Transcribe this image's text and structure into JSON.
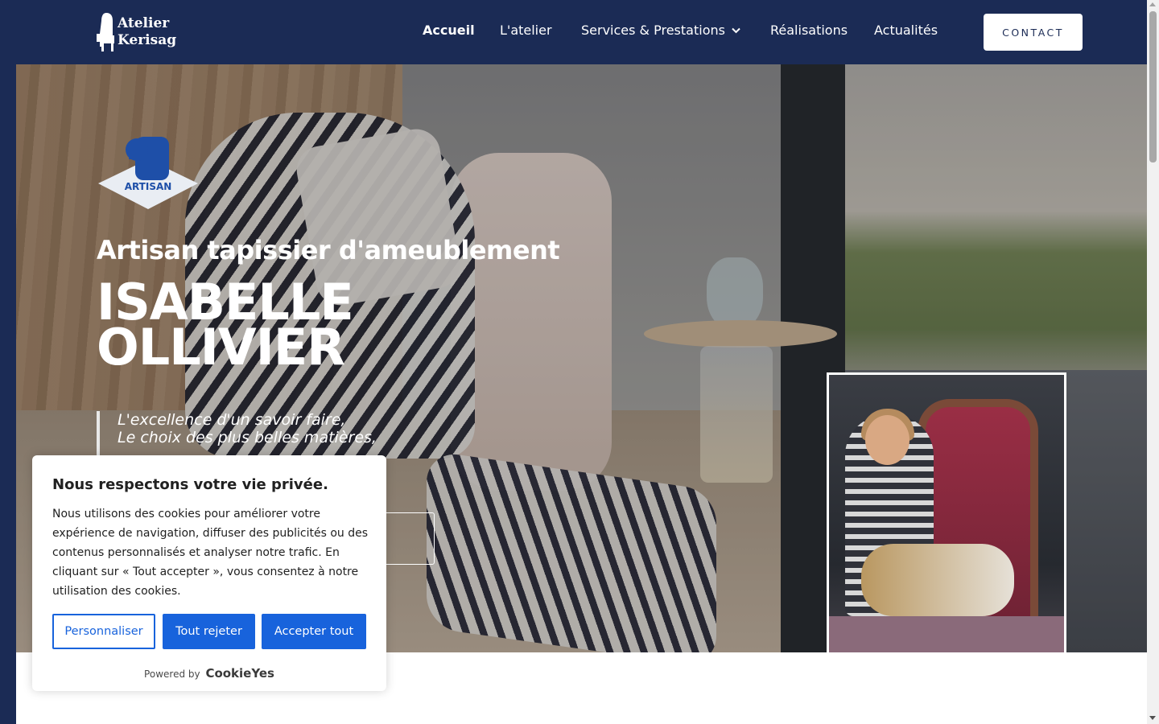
{
  "brand": {
    "line1": "Atelier",
    "line2": "Kerisag"
  },
  "nav": {
    "items": [
      {
        "label": "Accueil",
        "active": true
      },
      {
        "label": "L'atelier"
      },
      {
        "label": "Services & Prestations",
        "has_dropdown": true
      },
      {
        "label": "Réalisations"
      },
      {
        "label": "Actualités"
      }
    ],
    "contact_label": "CONTACT"
  },
  "hero": {
    "badge_label": "ARTISAN",
    "subtitle": "Artisan tapissier d'ameublement",
    "title_line1": "ISABELLE",
    "title_line2": "OLLIVIER",
    "quote_line1": "L'excellence d'un savoir faire,",
    "quote_line2": "Le choix des plus belles matières,"
  },
  "cookie": {
    "title": "Nous respectons votre vie privée.",
    "text": "Nous utilisons des cookies pour améliorer votre expérience de navigation, diffuser des publicités ou des contenus personnalisés et analyser notre trafic. En cliquant sur « Tout accepter », vous consentez à notre utilisation des cookies.",
    "customize_label": "Personnaliser",
    "reject_label": "Tout rejeter",
    "accept_label": "Accepter tout",
    "powered_by": "Powered by",
    "provider": "CookieYes"
  },
  "colors": {
    "header_bg": "#1b2b55",
    "cookie_accent": "#1863dc",
    "white": "#ffffff"
  }
}
